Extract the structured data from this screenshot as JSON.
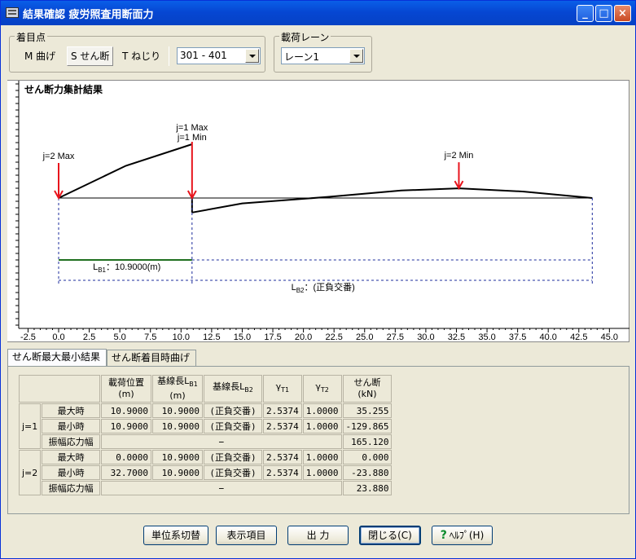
{
  "window": {
    "title": "結果確認 疲労照査用断面力",
    "minimize": "_",
    "maximize": "□",
    "close": "×"
  },
  "focus_group": {
    "legend": "着目点",
    "tabs": [
      "M 曲げ",
      "S せん断",
      "T ねじり"
    ],
    "active_tab": "S せん断",
    "range_value": "301 - 401"
  },
  "lane_group": {
    "legend": "載荷レーン",
    "value": "レーン1"
  },
  "chart_data": {
    "type": "line",
    "title": "せん断力集計結果",
    "x_ticks": [
      "-2.5",
      "0.0",
      "2.5",
      "5.0",
      "7.5",
      "10.0",
      "12.5",
      "15.0",
      "17.5",
      "20.0",
      "22.5",
      "25.0",
      "27.5",
      "30.0",
      "32.5",
      "35.0",
      "37.5",
      "40.0",
      "42.5",
      "45.0"
    ],
    "xlim": [
      -2.5,
      45.0
    ],
    "series": [
      {
        "name": "",
        "x": [
          0.0,
          5.5,
          10.9
        ],
        "y": [
          0.0,
          0.6,
          1.0
        ]
      },
      {
        "name": "",
        "x": [
          10.9,
          15.0,
          22.0,
          28.0,
          32.7,
          38.0,
          43.6
        ],
        "y": [
          -0.27,
          -0.1,
          0.02,
          0.14,
          0.18,
          0.12,
          0.0
        ]
      }
    ],
    "annotations": [
      {
        "text": "j=2 Max",
        "x": 0.0
      },
      {
        "text": "j=1 Max",
        "x": 10.9
      },
      {
        "text": "j=1 Min",
        "x": 10.9
      },
      {
        "text": "j=2 Min",
        "x": 32.7
      }
    ],
    "lb1_label": "L",
    "lb1_sub": "B1",
    "lb1_value": "：10.9000(m)",
    "lb2_label": "L",
    "lb2_sub": "B2",
    "lb2_value": "：(正負交番)",
    "colors": {
      "arrow": "#e8141c",
      "curve": "#000000",
      "lb1_line": "#207020",
      "dim_line": "#1c2c9c"
    }
  },
  "result_tabs": [
    "せん断最大最小結果",
    "せん断着目時曲げ"
  ],
  "table": {
    "headers": [
      "載荷位置\n(m)",
      "基線長L\n(m)",
      "基線長L",
      "γT1",
      "γT2",
      "せん断\n(kN)"
    ],
    "h_load_pos": "載荷位置",
    "h_load_pos_unit": "(m)",
    "h_base1": "基線長L",
    "h_base1_sub": "B1",
    "h_base1_unit": "(m)",
    "h_base2": "基線長L",
    "h_base2_sub": "B2",
    "h_g1": "γ",
    "h_g1_sub": "T1",
    "h_g2": "γ",
    "h_g2_sub": "T2",
    "h_shear": "せん断",
    "h_shear_unit": "(kN)",
    "groups": [
      {
        "label": "j=1",
        "rows": [
          {
            "name": "最大時",
            "pos": "10.9000",
            "lb1": "10.9000",
            "lb2": "(正負交番)",
            "g1": "2.5374",
            "g2": "1.0000",
            "shear": "35.255"
          },
          {
            "name": "最小時",
            "pos": "10.9000",
            "lb1": "10.9000",
            "lb2": "(正負交番)",
            "g1": "2.5374",
            "g2": "1.0000",
            "shear": "-129.865"
          }
        ],
        "amp_name": "振幅応力幅",
        "amp_dash": "−",
        "amp_value": "165.120"
      },
      {
        "label": "j=2",
        "rows": [
          {
            "name": "最大時",
            "pos": "0.0000",
            "lb1": "10.9000",
            "lb2": "(正負交番)",
            "g1": "2.5374",
            "g2": "1.0000",
            "shear": "0.000"
          },
          {
            "name": "最小時",
            "pos": "32.7000",
            "lb1": "10.9000",
            "lb2": "(正負交番)",
            "g1": "2.5374",
            "g2": "1.0000",
            "shear": "-23.880"
          }
        ],
        "amp_name": "振幅応力幅",
        "amp_dash": "−",
        "amp_value": "23.880"
      }
    ]
  },
  "buttons": {
    "unit_switch": "単位系切替",
    "display_items": "表示項目",
    "output": "出 力",
    "close": "閉じる(C)",
    "help": "ﾍﾙﾌﾟ(H)"
  }
}
